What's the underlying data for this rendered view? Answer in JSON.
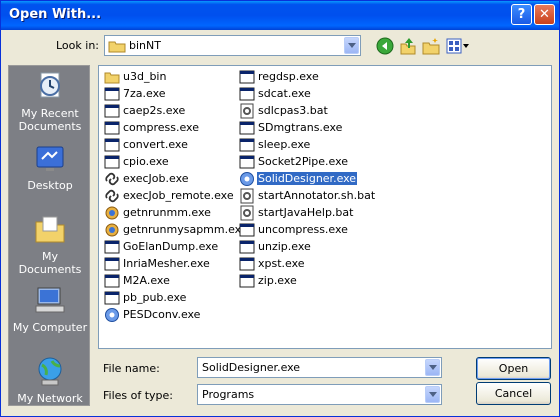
{
  "window": {
    "title": "Open With..."
  },
  "toolbar": {
    "look_in_label": "Look in:",
    "look_in_value": "binNT"
  },
  "places": [
    {
      "label_1": "My Recent",
      "label_2": "Documents",
      "icon": "recent-documents-icon"
    },
    {
      "label_1": "Desktop",
      "label_2": "",
      "icon": "desktop-icon"
    },
    {
      "label_1": "My Documents",
      "label_2": "",
      "icon": "my-documents-icon"
    },
    {
      "label_1": "My Computer",
      "label_2": "",
      "icon": "my-computer-icon"
    },
    {
      "label_1": "My Network",
      "label_2": "",
      "icon": "my-network-icon"
    }
  ],
  "files_col1": [
    {
      "name": "u3d_bin",
      "icon": "folder"
    },
    {
      "name": "7za.exe",
      "icon": "exe"
    },
    {
      "name": "caep2s.exe",
      "icon": "exe"
    },
    {
      "name": "compress.exe",
      "icon": "exe"
    },
    {
      "name": "convert.exe",
      "icon": "exe"
    },
    {
      "name": "cpio.exe",
      "icon": "exe"
    },
    {
      "name": "execJob.exe",
      "icon": "link"
    },
    {
      "name": "execJob_remote.exe",
      "icon": "link"
    },
    {
      "name": "getnrunmm.exe",
      "icon": "app"
    },
    {
      "name": "getnrunmysapmm.exe",
      "icon": "app"
    },
    {
      "name": "GoElanDump.exe",
      "icon": "exe"
    },
    {
      "name": "InriaMesher.exe",
      "icon": "exe"
    },
    {
      "name": "M2A.exe",
      "icon": "exe"
    },
    {
      "name": "pb_pub.exe",
      "icon": "exe"
    },
    {
      "name": "PESDconv.exe",
      "icon": "gear"
    }
  ],
  "files_col2": [
    {
      "name": "regdsp.exe",
      "icon": "exe"
    },
    {
      "name": "sdcat.exe",
      "icon": "exe"
    },
    {
      "name": "sdlcpas3.bat",
      "icon": "bat"
    },
    {
      "name": "SDmgtrans.exe",
      "icon": "exe"
    },
    {
      "name": "sleep.exe",
      "icon": "exe"
    },
    {
      "name": "Socket2Pipe.exe",
      "icon": "exe"
    },
    {
      "name": "SolidDesigner.exe",
      "icon": "gear",
      "selected": true
    },
    {
      "name": "startAnnotator.sh.bat",
      "icon": "bat"
    },
    {
      "name": "startJavaHelp.bat",
      "icon": "bat"
    },
    {
      "name": "uncompress.exe",
      "icon": "exe"
    },
    {
      "name": "unzip.exe",
      "icon": "exe"
    },
    {
      "name": "xpst.exe",
      "icon": "exe"
    },
    {
      "name": "zip.exe",
      "icon": "exe"
    }
  ],
  "footer": {
    "file_name_label": "File name:",
    "file_name_value": "SolidDesigner.exe",
    "file_type_label": "Files of type:",
    "file_type_value": "Programs",
    "open_label": "Open",
    "cancel_label": "Cancel"
  },
  "colors": {
    "title_blue": "#0053ee",
    "selection": "#316ac5",
    "dialog_bg": "#ece9d8"
  }
}
